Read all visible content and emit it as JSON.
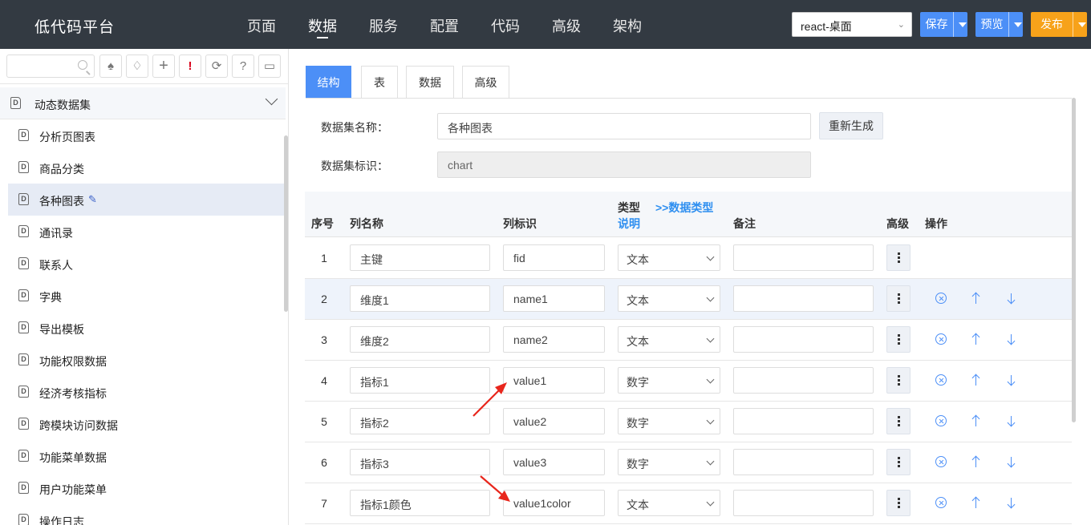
{
  "header": {
    "app_title": "低代码平台",
    "nav": [
      "页面",
      "数据",
      "服务",
      "配置",
      "代码",
      "高级",
      "架构"
    ],
    "active_nav": "数据",
    "platform_value": "react-桌面",
    "save_label": "保存",
    "preview_label": "预览",
    "publish_label": "发布"
  },
  "sidebar": {
    "search_placeholder": "",
    "toolbar_icons": [
      "tree-icon",
      "tag-icon",
      "plus-icon",
      "exclamation-icon",
      "refresh-icon",
      "help-icon",
      "comment-icon"
    ],
    "root_label": "动态数据集",
    "items": [
      {
        "label": "分析页图表"
      },
      {
        "label": "商品分类"
      },
      {
        "label": "各种图表",
        "selected": true
      },
      {
        "label": "通讯录"
      },
      {
        "label": "联系人"
      },
      {
        "label": "字典"
      },
      {
        "label": "导出模板"
      },
      {
        "label": "功能权限数据"
      },
      {
        "label": "经济考核指标"
      },
      {
        "label": "跨模块访问数据"
      },
      {
        "label": "功能菜单数据"
      },
      {
        "label": "用户功能菜单"
      },
      {
        "label": "操作日志"
      }
    ]
  },
  "main": {
    "tabs": [
      "结构",
      "表",
      "数据",
      "高级"
    ],
    "active_tab": "结构",
    "form": {
      "name_label": "数据集名称：",
      "name_value": "各种图表",
      "regen_label": "重新生成",
      "id_label": "数据集标识：",
      "id_value": "chart"
    },
    "table": {
      "headers": {
        "seq": "序号",
        "col_name": "列名称",
        "col_id": "列标识",
        "type_line1": "类型",
        "type_line2": "说明",
        "data_type_link": ">>数据类型",
        "note": "备注",
        "adv": "高级",
        "ops": "操作"
      },
      "rows": [
        {
          "seq": "1",
          "name": "主键",
          "id": "fid",
          "type": "文本",
          "note": "",
          "ops": false
        },
        {
          "seq": "2",
          "name": "维度1",
          "id": "name1",
          "type": "文本",
          "note": "",
          "ops": true
        },
        {
          "seq": "3",
          "name": "维度2",
          "id": "name2",
          "type": "文本",
          "note": "",
          "ops": true
        },
        {
          "seq": "4",
          "name": "指标1",
          "id": "value1",
          "type": "数字",
          "note": "",
          "ops": true
        },
        {
          "seq": "5",
          "name": "指标2",
          "id": "value2",
          "type": "数字",
          "note": "",
          "ops": true
        },
        {
          "seq": "6",
          "name": "指标3",
          "id": "value3",
          "type": "数字",
          "note": "",
          "ops": true
        },
        {
          "seq": "7",
          "name": "指标1颜色",
          "id": "value1color",
          "type": "文本",
          "note": "",
          "ops": true
        }
      ]
    }
  },
  "colors": {
    "topbar": "#333a42",
    "primary": "#4c8ff7",
    "publish": "#f7a21a",
    "annotation_arrow": "#e8261c"
  }
}
